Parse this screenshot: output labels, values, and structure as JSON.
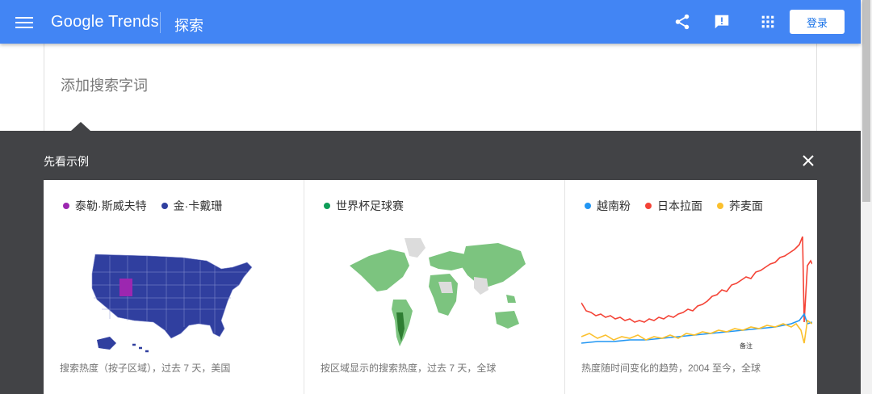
{
  "header": {
    "logo_text": "Google Trends",
    "title": "探索",
    "login_label": "登录",
    "icons": [
      "menu-icon",
      "share-icon",
      "feedback-icon",
      "apps-grid-icon"
    ],
    "background_color": "#4285f4"
  },
  "search": {
    "placeholder": "添加搜索字词",
    "value": ""
  },
  "examples": {
    "title": "先看示例",
    "close_icon": "close-icon",
    "cards": [
      {
        "legend": [
          {
            "label": "泰勒·斯威夫特",
            "color": "#9c27b0"
          },
          {
            "label": "金·卡戴珊",
            "color": "#303f9f"
          }
        ],
        "caption": "搜索热度（按子区域），过去 7 天，美国"
      },
      {
        "legend": [
          {
            "label": "世界杯足球赛",
            "color": "#0f9d58"
          }
        ],
        "caption": "按区域显示的搜索热度，过去 7 天，全球"
      },
      {
        "legend": [
          {
            "label": "越南粉",
            "color": "#2196f3"
          },
          {
            "label": "日本拉面",
            "color": "#f44336"
          },
          {
            "label": "荞麦面",
            "color": "#fbc02d"
          }
        ],
        "note_label": "备注",
        "caption": "热度随时间变化的趋势，2004 至今，全球"
      }
    ]
  }
}
